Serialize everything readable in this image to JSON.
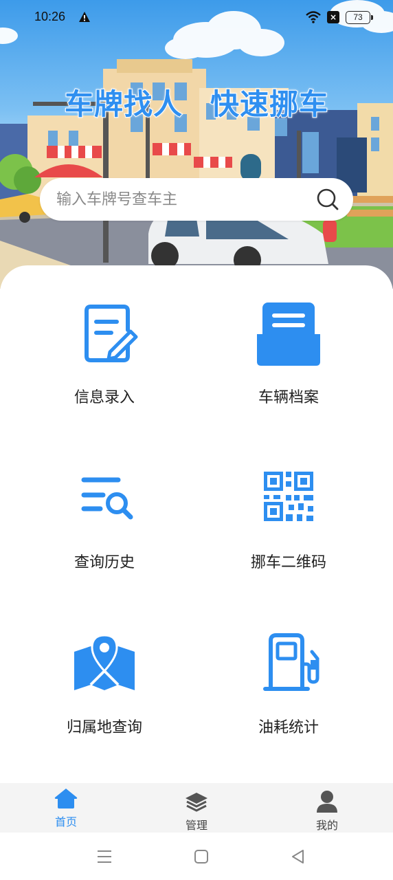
{
  "status_bar": {
    "time": "10:26",
    "battery": "73",
    "icons": [
      "alert-icon",
      "wifi-icon",
      "no-sim-icon",
      "battery-icon"
    ]
  },
  "hero": {
    "title_left": "车牌找人",
    "title_right": "快速挪车"
  },
  "search": {
    "placeholder": "输入车牌号查车主",
    "value": "",
    "icon": "search-icon"
  },
  "grid": {
    "items": [
      {
        "label": "信息录入",
        "icon": "edit-document-icon"
      },
      {
        "label": "车辆档案",
        "icon": "archive-drawer-icon"
      },
      {
        "label": "查询历史",
        "icon": "list-search-icon"
      },
      {
        "label": "挪车二维码",
        "icon": "qr-code-icon"
      },
      {
        "label": "归属地查询",
        "icon": "map-location-icon"
      },
      {
        "label": "油耗统计",
        "icon": "fuel-pump-icon"
      }
    ]
  },
  "tabbar": {
    "tabs": [
      {
        "label": "首页",
        "icon": "home-icon",
        "active": true
      },
      {
        "label": "管理",
        "icon": "layers-icon",
        "active": false
      },
      {
        "label": "我的",
        "icon": "user-icon",
        "active": false
      }
    ]
  },
  "system_nav": {
    "icons": [
      "menu-icon",
      "home-square-icon",
      "back-triangle-icon"
    ]
  },
  "colors": {
    "accent": "#2d8ef0",
    "tab_inactive": "#555555",
    "tab_bar_bg": "#f4f4f4"
  }
}
